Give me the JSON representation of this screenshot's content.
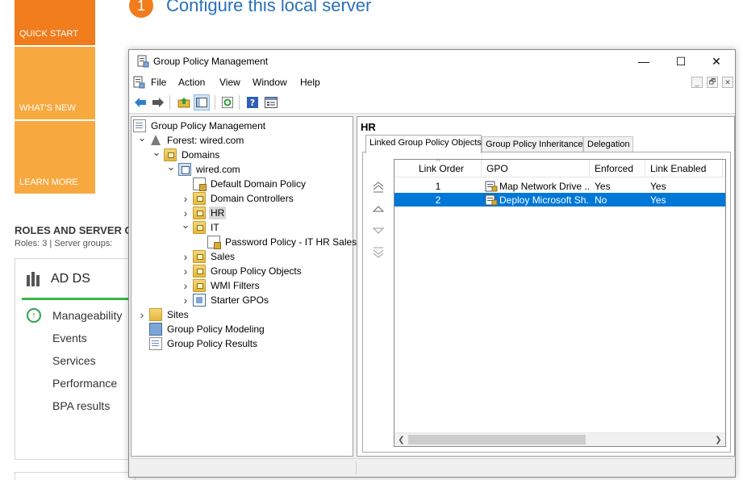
{
  "server_manager": {
    "tiles": [
      "QUICK START",
      "WHAT'S NEW",
      "LEARN MORE"
    ],
    "step_number": "1",
    "configure_title": "Configure this local server",
    "roles_title": "ROLES AND SERVER G",
    "roles_sub": "Roles: 3   |   Server groups:",
    "card": {
      "title": "AD DS",
      "items": [
        "Manageability",
        "Events",
        "Services",
        "Performance",
        "BPA results"
      ]
    }
  },
  "window": {
    "title": "Group Policy Management",
    "buttons": {
      "minimize": "—",
      "maximize": "☐",
      "close": "✕"
    }
  },
  "menu": [
    "File",
    "Action",
    "View",
    "Window",
    "Help"
  ],
  "mdi_buttons": [
    "_",
    "🗗",
    "✕"
  ],
  "toolbar_icons": [
    "back-arrow-icon",
    "forward-arrow-icon",
    "up-folder-icon",
    "show-hide-tree-icon",
    "refresh-icon",
    "help-icon",
    "properties-icon"
  ],
  "tree": [
    {
      "label": "Group Policy Management",
      "level": 0,
      "expander": "",
      "icon": "gpm"
    },
    {
      "label": "Forest: wired.com",
      "level": 1,
      "expander": "v",
      "icon": "forest"
    },
    {
      "label": "Domains",
      "level": 2,
      "expander": "v",
      "icon": "folder"
    },
    {
      "label": "wired.com",
      "level": 3,
      "expander": "v",
      "icon": "domain"
    },
    {
      "label": "Default Domain Policy",
      "level": 4,
      "expander": "",
      "icon": "gpo"
    },
    {
      "label": "Domain Controllers",
      "level": 4,
      "expander": ">",
      "icon": "folder"
    },
    {
      "label": "HR",
      "level": 4,
      "expander": ">",
      "icon": "folder",
      "selected": true
    },
    {
      "label": "IT",
      "level": 4,
      "expander": "v",
      "icon": "folder"
    },
    {
      "label": "Password Policy - IT HR Sales",
      "level": 5,
      "expander": "",
      "icon": "gpo"
    },
    {
      "label": "Sales",
      "level": 4,
      "expander": ">",
      "icon": "folder"
    },
    {
      "label": "Group Policy Objects",
      "level": 4,
      "expander": ">",
      "icon": "folder"
    },
    {
      "label": "WMI Filters",
      "level": 4,
      "expander": ">",
      "icon": "folder"
    },
    {
      "label": "Starter GPOs",
      "level": 4,
      "expander": ">",
      "icon": "starter"
    },
    {
      "label": "Sites",
      "level": 1,
      "expander": ">",
      "icon": "folder-plain"
    },
    {
      "label": "Group Policy Modeling",
      "level": 1,
      "expander": "",
      "icon": "blue"
    },
    {
      "label": "Group Policy Results",
      "level": 1,
      "expander": "",
      "icon": "doc"
    }
  ],
  "details": {
    "title": "HR",
    "tabs": [
      "Linked Group Policy Objects",
      "Group Policy Inheritance",
      "Delegation"
    ],
    "columns": [
      "Link Order",
      "GPO",
      "Enforced",
      "Link Enabled"
    ],
    "rows": [
      {
        "order": "1",
        "gpo": "Map Network Drive ...",
        "enforced": "Yes",
        "enabled": "Yes"
      },
      {
        "order": "2",
        "gpo": "Deploy Microsoft Sh...",
        "enforced": "No",
        "enabled": "Yes",
        "selected": true
      }
    ]
  }
}
